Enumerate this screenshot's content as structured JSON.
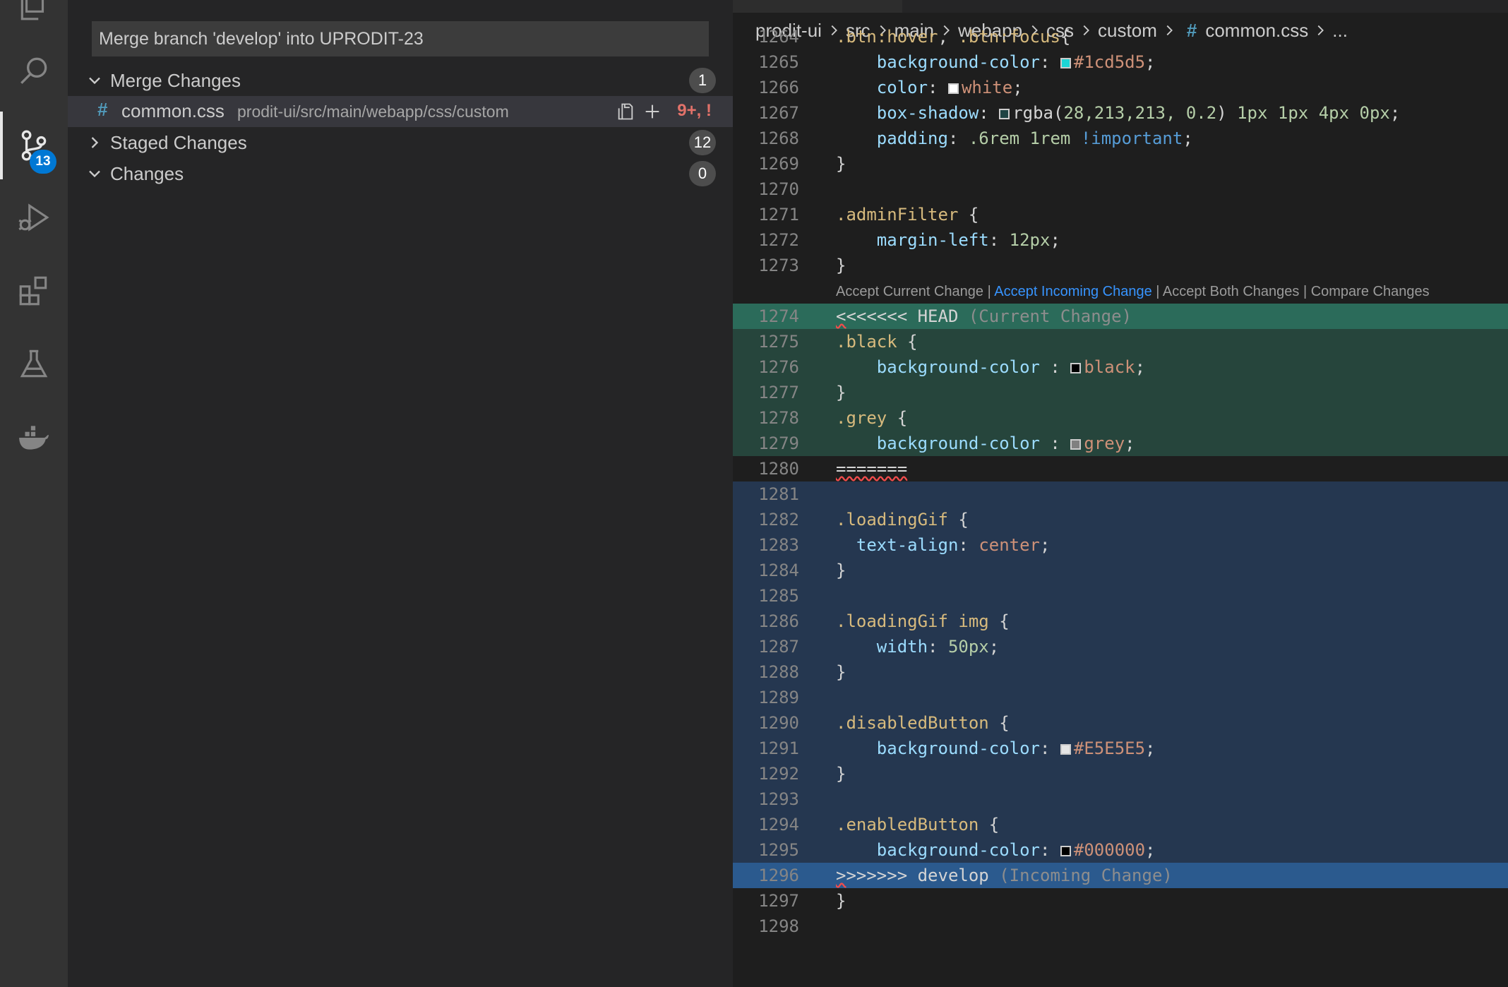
{
  "activity_bar": {
    "items": [
      {
        "name": "explorer-icon"
      },
      {
        "name": "search-icon"
      },
      {
        "name": "source-control-icon",
        "badge": "13",
        "active": true
      },
      {
        "name": "run-debug-icon"
      },
      {
        "name": "extensions-icon"
      },
      {
        "name": "testing-icon"
      },
      {
        "name": "docker-icon"
      }
    ]
  },
  "scm": {
    "commit_message": "Merge branch 'develop' into UPRODIT-23",
    "groups": [
      {
        "label": "Merge Changes",
        "count": "1",
        "expanded": true
      },
      {
        "label": "Staged Changes",
        "count": "12",
        "expanded": false
      },
      {
        "label": "Changes",
        "count": "0",
        "expanded": true
      }
    ],
    "file": {
      "icon": "#",
      "name": "common.css",
      "path": "prodit-ui/src/main/webapp/css/custom",
      "status": "9+, !"
    }
  },
  "breadcrumb": {
    "parts": [
      "prodit-ui",
      "src",
      "main",
      "webapp",
      "css",
      "custom"
    ],
    "file_hash": "#",
    "file": "common.css",
    "more": "..."
  },
  "codelens": {
    "accept_current": "Accept Current Change",
    "accept_incoming": "Accept Incoming Change",
    "accept_both": "Accept Both Changes",
    "compare": "Compare Changes",
    "separator": " | "
  },
  "colors": {
    "swatch_1cd5d5": "#1cd5d5",
    "swatch_white": "#ffffff",
    "swatch_rgba": "rgba(28,213,213,0.2)",
    "swatch_black": "#000000",
    "swatch_grey": "#808080",
    "swatch_e5": "#E5E5E5",
    "swatch_000": "#000000"
  },
  "code_lines": [
    {
      "n": "1264",
      "t": ".btn:hover, .btn:focus{"
    },
    {
      "n": "1265",
      "t": "    background-color: #1cd5d5;"
    },
    {
      "n": "1266",
      "t": "    color: white;"
    },
    {
      "n": "1267",
      "t": "    box-shadow: rgba(28,213,213, 0.2) 1px 1px 4px 0px;"
    },
    {
      "n": "1268",
      "t": "    padding: .6rem 1rem !important;"
    },
    {
      "n": "1269",
      "t": "}"
    },
    {
      "n": "1270",
      "t": ""
    },
    {
      "n": "1271",
      "t": ".adminFilter {"
    },
    {
      "n": "1272",
      "t": "    margin-left: 12px;"
    },
    {
      "n": "1273",
      "t": "}"
    },
    {
      "n": "1274",
      "t": "<<<<<<< HEAD (Current Change)"
    },
    {
      "n": "1275",
      "t": ".black {"
    },
    {
      "n": "1276",
      "t": "    background-color : black;"
    },
    {
      "n": "1277",
      "t": "}"
    },
    {
      "n": "1278",
      "t": ".grey {"
    },
    {
      "n": "1279",
      "t": "    background-color : grey;"
    },
    {
      "n": "1280",
      "t": "======="
    },
    {
      "n": "1281",
      "t": ""
    },
    {
      "n": "1282",
      "t": ".loadingGif {"
    },
    {
      "n": "1283",
      "t": "  text-align: center;"
    },
    {
      "n": "1284",
      "t": "}"
    },
    {
      "n": "1285",
      "t": ""
    },
    {
      "n": "1286",
      "t": ".loadingGif img {"
    },
    {
      "n": "1287",
      "t": "    width: 50px;"
    },
    {
      "n": "1288",
      "t": "}"
    },
    {
      "n": "1289",
      "t": ""
    },
    {
      "n": "1290",
      "t": ".disabledButton {"
    },
    {
      "n": "1291",
      "t": "    background-color: #E5E5E5;"
    },
    {
      "n": "1292",
      "t": "}"
    },
    {
      "n": "1293",
      "t": ""
    },
    {
      "n": "1294",
      "t": ".enabledButton {"
    },
    {
      "n": "1295",
      "t": "    background-color: #000000;"
    },
    {
      "n": "1296",
      "t": ">>>>>>> develop (Incoming Change)"
    },
    {
      "n": "1297",
      "t": "}"
    },
    {
      "n": "1298",
      "t": ""
    }
  ]
}
